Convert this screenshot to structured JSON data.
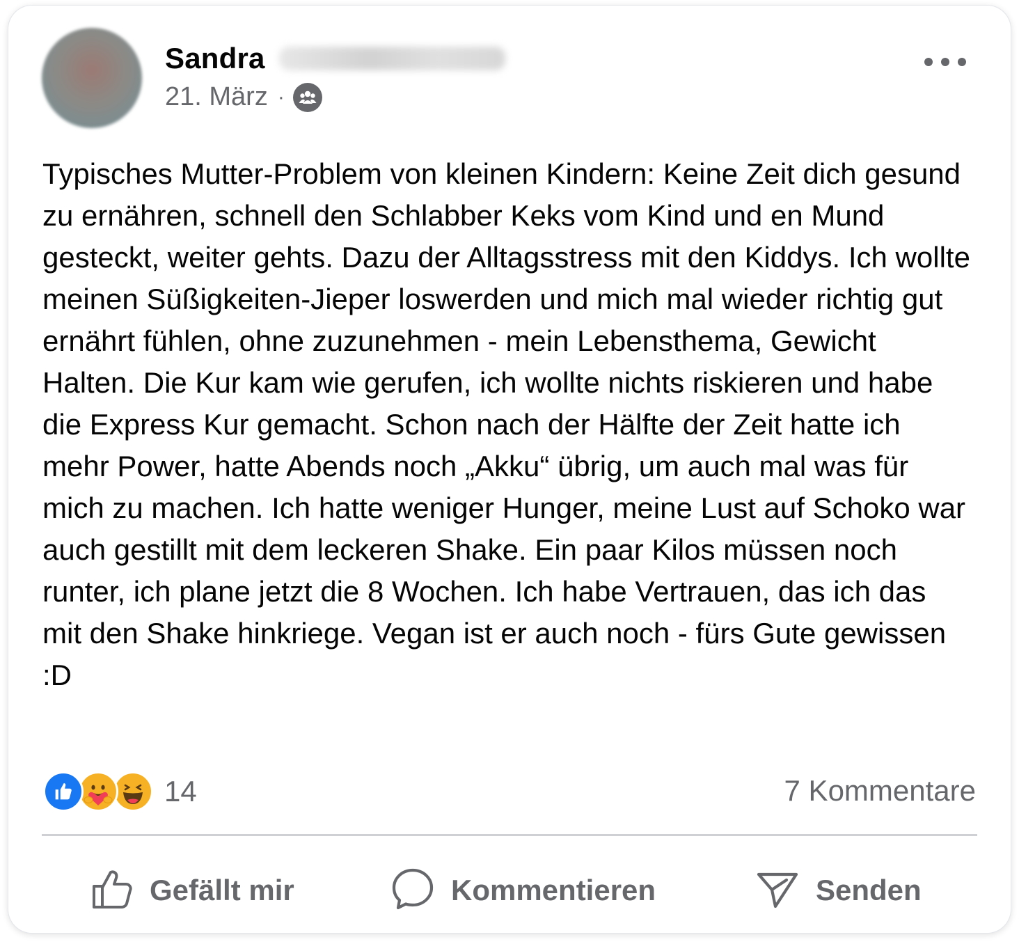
{
  "post": {
    "author_first_name": "Sandra",
    "date": "21. März",
    "meta_separator": "·",
    "audience_icon": "group-icon",
    "more_icon": "more-options-icon",
    "text": "Typisches Mutter-Problem von kleinen Kindern: Keine Zeit dich gesund zu ernähren, schnell den Schlabber Keks vom Kind und en Mund gesteckt, weiter gehts. Dazu der Alltagsstress mit den Kiddys. Ich wollte meinen Süßigkeiten-Jieper loswerden und mich mal wieder richtig gut ernährt fühlen, ohne zuzunehmen - mein Lebensthema, Gewicht Halten. Die Kur kam wie gerufen, ich wollte nichts riskieren und habe die Express Kur gemacht. Schon nach der Hälfte der Zeit hatte ich mehr Power, hatte Abends noch „Akku“ übrig, um auch mal was für mich zu machen. Ich hatte weniger Hunger, meine Lust auf Schoko war auch gestillt mit dem leckeren Shake. Ein paar Kilos müssen noch runter, ich plane jetzt die 8 Wochen. Ich habe Vertrauen, das ich das mit den Shake hinkriege. Vegan ist er auch noch - fürs Gute gewissen :D"
  },
  "stats": {
    "reactions": [
      "like-reaction-icon",
      "care-reaction-icon",
      "haha-reaction-icon"
    ],
    "reaction_count": "14",
    "comments": "7 Kommentare"
  },
  "actions": {
    "like": {
      "label": "Gefällt mir",
      "icon": "thumbs-up-icon"
    },
    "comment": {
      "label": "Kommentieren",
      "icon": "comment-bubble-icon"
    },
    "send": {
      "label": "Senden",
      "icon": "send-icon"
    }
  },
  "colors": {
    "text_primary": "#050505",
    "text_secondary": "#65676b",
    "like_blue": "#1877f2",
    "reaction_yellow": "#f7b125",
    "divider": "#ced0d4"
  }
}
